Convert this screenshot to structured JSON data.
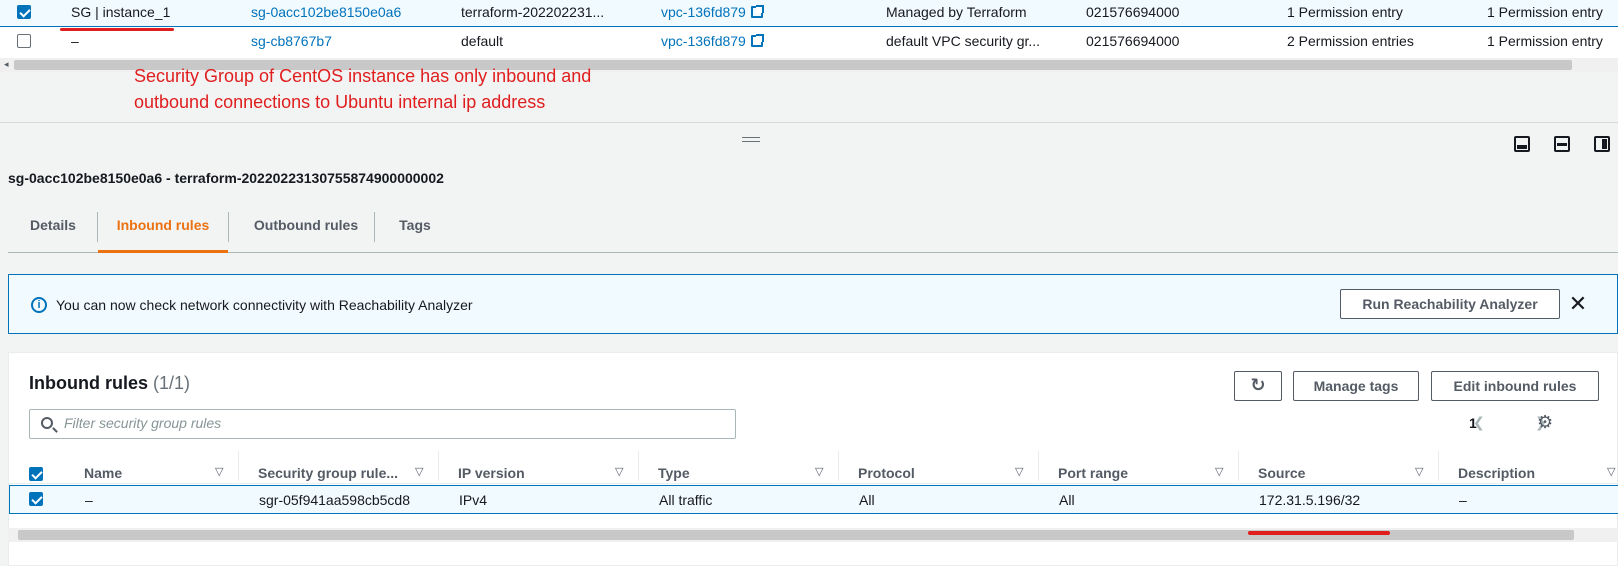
{
  "sg_table": {
    "rows": [
      {
        "name": "SG | instance_1",
        "id": "sg-0acc102be8150e0a6",
        "group_name": "terraform-202202231...",
        "vpc": "vpc-136fd879",
        "description": "Managed by Terraform",
        "owner": "021576694000",
        "inbound": "1 Permission entry",
        "outbound": "1 Permission entry",
        "selected": true
      },
      {
        "name": "–",
        "id": "sg-cb8767b7",
        "group_name": "default",
        "vpc": "vpc-136fd879",
        "description": "default VPC security gr...",
        "owner": "021576694000",
        "inbound": "2 Permission entries",
        "outbound": "1 Permission entry",
        "selected": false
      }
    ]
  },
  "annotation": {
    "text": "Security Group of CentOS instance has only inbound and outbound connections to Ubuntu internal ip address",
    "color": "#e01e1e"
  },
  "details": {
    "title": "sg-0acc102be8150e0a6 - terraform-20220223130755874900000002",
    "tabs": [
      {
        "label": "Details",
        "active": false
      },
      {
        "label": "Inbound rules",
        "active": true
      },
      {
        "label": "Outbound rules",
        "active": false
      },
      {
        "label": "Tags",
        "active": false
      }
    ]
  },
  "alert": {
    "icon": "info-icon",
    "text": "You can now check network connectivity with Reachability Analyzer",
    "button": "Run Reachability Analyzer",
    "close_icon": "close-icon"
  },
  "inbound_rules": {
    "title": "Inbound rules",
    "count": "(1/1)",
    "refresh_icon": "refresh-icon",
    "manage_tags": "Manage tags",
    "edit_button": "Edit inbound rules",
    "filter_placeholder": "Filter security group rules",
    "page": "1",
    "columns": [
      "Name",
      "Security group rule...",
      "IP version",
      "Type",
      "Protocol",
      "Port range",
      "Source",
      "Description"
    ],
    "rows": [
      {
        "name": "–",
        "rule_id": "sgr-05f941aa598cb5cd8",
        "ip_version": "IPv4",
        "type": "All traffic",
        "protocol": "All",
        "port_range": "All",
        "source": "172.31.5.196/32",
        "description": "–",
        "selected": true
      }
    ]
  },
  "colors": {
    "accent": "#0073bb",
    "active_tab": "#ec7211",
    "annotation": "#e01e1e"
  }
}
